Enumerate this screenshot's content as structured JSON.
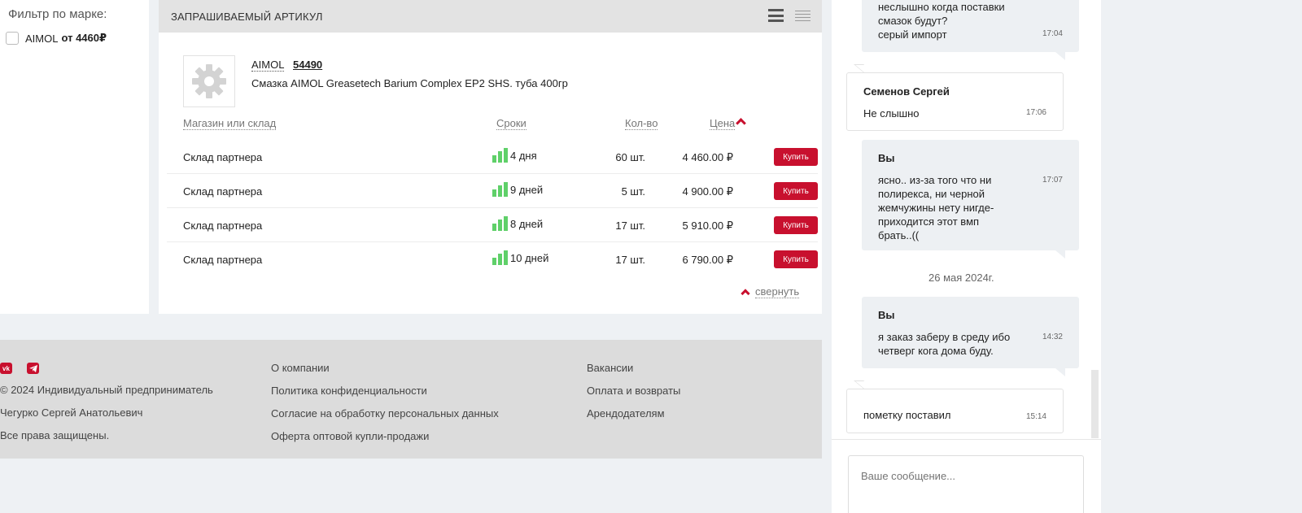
{
  "filter": {
    "title": "Фильтр по марке:",
    "item_brand": "AIMOL",
    "item_from": "от",
    "item_price": "4460₽"
  },
  "panel": {
    "header": "ЗАПРАШИВАЕМЫЙ АРТИКУЛ",
    "product": {
      "brand": "AIMOL",
      "code": "54490",
      "name": "Смазка AIMOL Greasetech Barium Complex EP2 SHS. туба 400гр",
      "image_icon": "gear-icon"
    },
    "columns": {
      "store": "Магазин или склад",
      "term": "Сроки",
      "qty": "Кол-во",
      "price": "Цена"
    },
    "rows": [
      {
        "store": "Склад партнера",
        "term": "4 дня",
        "qty": "60 шт.",
        "price": "4 460.00 ₽",
        "buy": "Купить"
      },
      {
        "store": "Склад партнера",
        "term": "9 дней",
        "qty": "5 шт.",
        "price": "4 900.00 ₽",
        "buy": "Купить"
      },
      {
        "store": "Склад партнера",
        "term": "8 дней",
        "qty": "17 шт.",
        "price": "5 910.00 ₽",
        "buy": "Купить"
      },
      {
        "store": "Склад партнера",
        "term": "10 дней",
        "qty": "17 шт.",
        "price": "6 790.00 ₽",
        "buy": "Купить"
      }
    ],
    "collapse": "свернуть"
  },
  "footer": {
    "social": {
      "vk": "vk",
      "telegram": "tg"
    },
    "col1": [
      "© 2024 Индивидуальный предприниматель",
      "Чегурко Сергей Анатольевич",
      "Все права защищены."
    ],
    "col2": [
      "О компании",
      "Политика конфиденциальности",
      "Согласие на обработку персональных данных",
      "Оферта оптовой купли-продажи"
    ],
    "col3": [
      "Вакансии",
      "Оплата и возвраты",
      "Арендодателям"
    ]
  },
  "chat": {
    "messages": [
      {
        "lines": [
          "неслышно когда поставки",
          "смазок будут?",
          "серый импорт"
        ],
        "time": "17:04"
      },
      {
        "author": "Семенов Сергей",
        "lines": [
          "Не слышно"
        ],
        "time": "17:06"
      },
      {
        "author": "Вы",
        "lines": [
          "ясно.. из-за того что ни",
          "полирекса, ни черной",
          "жемчужины нету нигде-",
          "приходится этот вмп",
          "брать..(("
        ],
        "time": "17:07"
      },
      {
        "date": "26 мая 2024г."
      },
      {
        "author": "Вы",
        "lines": [
          "я заказ заберу в среду ибо",
          "четверг кога дома буду."
        ],
        "time": "14:32"
      },
      {
        "lines": [
          "пометку поставил"
        ],
        "time": "15:14"
      }
    ],
    "composer_placeholder": "Ваше сообщение..."
  },
  "colors": {
    "accent": "#c8102e",
    "bars": "#5fd069",
    "header_bg": "#e3e3e3",
    "footer_bg": "#dcdcdc"
  }
}
